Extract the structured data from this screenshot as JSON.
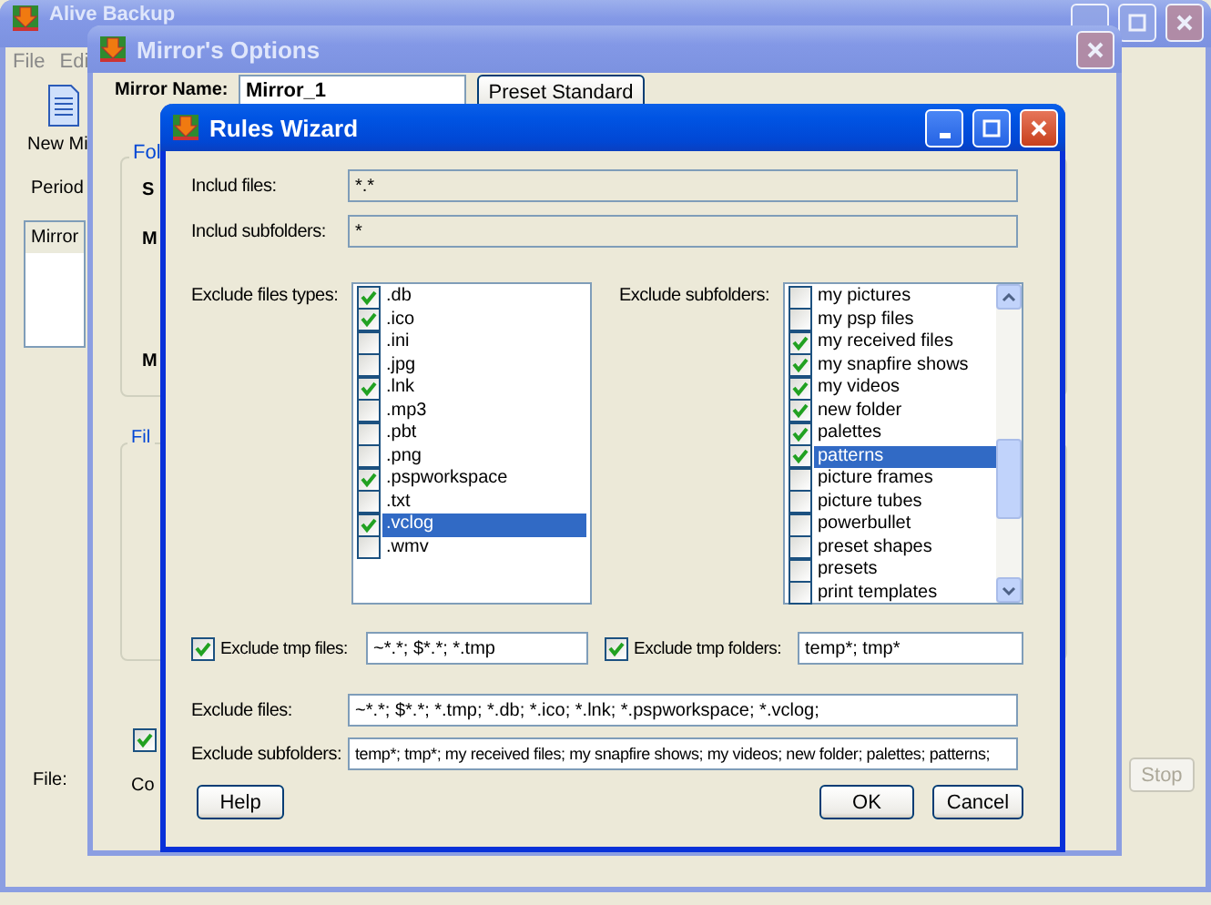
{
  "main_window": {
    "title": "Alive Backup",
    "menu": [
      "File",
      "Edi"
    ],
    "toolbar_label": "New Mi",
    "period_label": "Period",
    "list_header": "Mirror",
    "file_label": "File:",
    "stop_button": "Stop"
  },
  "options_window": {
    "title": "Mirror's Options",
    "name_label": "Mirror Name:",
    "name_value": "Mirror_1",
    "preset_button": "Preset Standard",
    "folders_group": "Fol",
    "folder_labels": [
      "S",
      "M",
      "M"
    ],
    "filters_group": "Fil",
    "auto_checkbox": {
      "checked": true
    },
    "com_label": "Co"
  },
  "rules_wizard": {
    "title": "Rules Wizard",
    "include_files": {
      "label": "Includ files:",
      "value": "*.*"
    },
    "include_subfolders": {
      "label": "Includ subfolders:",
      "value": "*"
    },
    "file_types": {
      "label": "Exclude files types:",
      "items": [
        {
          "label": ".db",
          "checked": true,
          "selected": false
        },
        {
          "label": ".ico",
          "checked": true,
          "selected": false
        },
        {
          "label": ".ini",
          "checked": false,
          "selected": false
        },
        {
          "label": ".jpg",
          "checked": false,
          "selected": false
        },
        {
          "label": ".lnk",
          "checked": true,
          "selected": false
        },
        {
          "label": ".mp3",
          "checked": false,
          "selected": false
        },
        {
          "label": ".pbt",
          "checked": false,
          "selected": false
        },
        {
          "label": ".png",
          "checked": false,
          "selected": false
        },
        {
          "label": ".pspworkspace",
          "checked": true,
          "selected": false
        },
        {
          "label": ".txt",
          "checked": false,
          "selected": false
        },
        {
          "label": ".vclog",
          "checked": true,
          "selected": true
        },
        {
          "label": ".wmv",
          "checked": false,
          "selected": false
        }
      ]
    },
    "subfolders": {
      "label": "Exclude subfolders:",
      "items": [
        {
          "label": "my pictures",
          "checked": false,
          "selected": false
        },
        {
          "label": "my psp files",
          "checked": false,
          "selected": false
        },
        {
          "label": "my received files",
          "checked": true,
          "selected": false
        },
        {
          "label": "my snapfire shows",
          "checked": true,
          "selected": false
        },
        {
          "label": "my videos",
          "checked": true,
          "selected": false
        },
        {
          "label": "new folder",
          "checked": true,
          "selected": false
        },
        {
          "label": "palettes",
          "checked": true,
          "selected": false
        },
        {
          "label": "patterns",
          "checked": true,
          "selected": true
        },
        {
          "label": "picture frames",
          "checked": false,
          "selected": false
        },
        {
          "label": "picture tubes",
          "checked": false,
          "selected": false
        },
        {
          "label": "powerbullet",
          "checked": false,
          "selected": false
        },
        {
          "label": "preset shapes",
          "checked": false,
          "selected": false
        },
        {
          "label": "presets",
          "checked": false,
          "selected": false
        },
        {
          "label": "print templates",
          "checked": false,
          "selected": false
        }
      ]
    },
    "tmp_files": {
      "label": "Exclude tmp files:",
      "checked": true,
      "value": "~*.*; $*.*; *.tmp"
    },
    "tmp_folders": {
      "label": "Exclude tmp folders:",
      "checked": true,
      "value": "temp*; tmp*"
    },
    "exclude_files": {
      "label": "Exclude files:",
      "value": "~*.*; $*.*; *.tmp; *.db; *.ico; *.lnk; *.pspworkspace; *.vclog;"
    },
    "exclude_subfolders": {
      "label": "Exclude subfolders:",
      "value": "temp*; tmp*; my received files; my snapfire shows; my videos; new folder; palettes; patterns;"
    },
    "buttons": {
      "help": "Help",
      "ok": "OK",
      "cancel": "Cancel"
    }
  }
}
